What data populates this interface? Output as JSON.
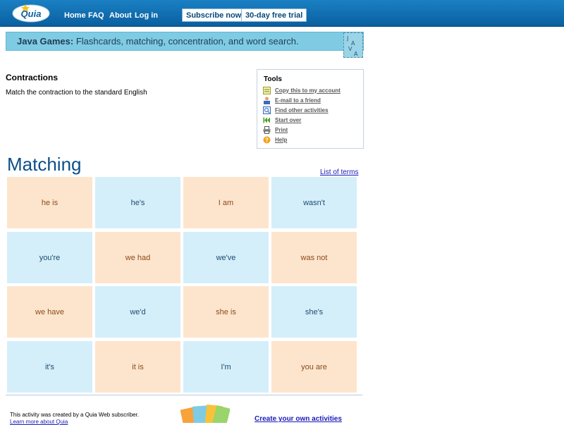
{
  "header": {
    "logo_text": "Quia",
    "nav": [
      "Home",
      "FAQ",
      "About",
      "Log in"
    ],
    "subscribe_label": "Subscribe now",
    "trial_label": "30-day free trial"
  },
  "banner": {
    "bold": "Java Games:",
    "text": " Flashcards, matching, concentration, and word search.",
    "badge_text": "JAVA"
  },
  "activity": {
    "title": "Contractions",
    "description": "Match the contraction to the standard English"
  },
  "tools": {
    "title": "Tools",
    "items": [
      {
        "label": "Copy this to my account",
        "icon": "copy-icon"
      },
      {
        "label": "E-mail to a friend",
        "icon": "email-friend-icon"
      },
      {
        "label": "Find other activities",
        "icon": "find-icon"
      },
      {
        "label": "Start over",
        "icon": "start-over-icon"
      },
      {
        "label": "Print",
        "icon": "print-icon"
      },
      {
        "label": "Help",
        "icon": "help-icon"
      }
    ]
  },
  "matching": {
    "title": "Matching",
    "list_link": "List of terms",
    "rows": [
      [
        {
          "text": "he is",
          "color": "peach"
        },
        {
          "text": "he's",
          "color": "blue"
        },
        {
          "text": "I am",
          "color": "peach"
        },
        {
          "text": "wasn't",
          "color": "blue"
        }
      ],
      [
        {
          "text": "you're",
          "color": "blue"
        },
        {
          "text": "we had",
          "color": "peach"
        },
        {
          "text": "we've",
          "color": "blue"
        },
        {
          "text": "was not",
          "color": "peach"
        }
      ],
      [
        {
          "text": "we have",
          "color": "peach"
        },
        {
          "text": "we'd",
          "color": "blue"
        },
        {
          "text": "she is",
          "color": "peach"
        },
        {
          "text": "she's",
          "color": "blue"
        }
      ],
      [
        {
          "text": "it's",
          "color": "blue"
        },
        {
          "text": "it is",
          "color": "peach"
        },
        {
          "text": "I'm",
          "color": "blue"
        },
        {
          "text": "you are",
          "color": "peach"
        }
      ]
    ]
  },
  "footer": {
    "created_text": "This activity was created by a Quia Web subscriber.",
    "learn_more": "Learn more about Quia",
    "create_link": "Create your own activities"
  },
  "colors": {
    "peach": "#fde5cd",
    "blue": "#d4effa",
    "header": "#0a5f9e",
    "banner": "#7fcbe3"
  }
}
